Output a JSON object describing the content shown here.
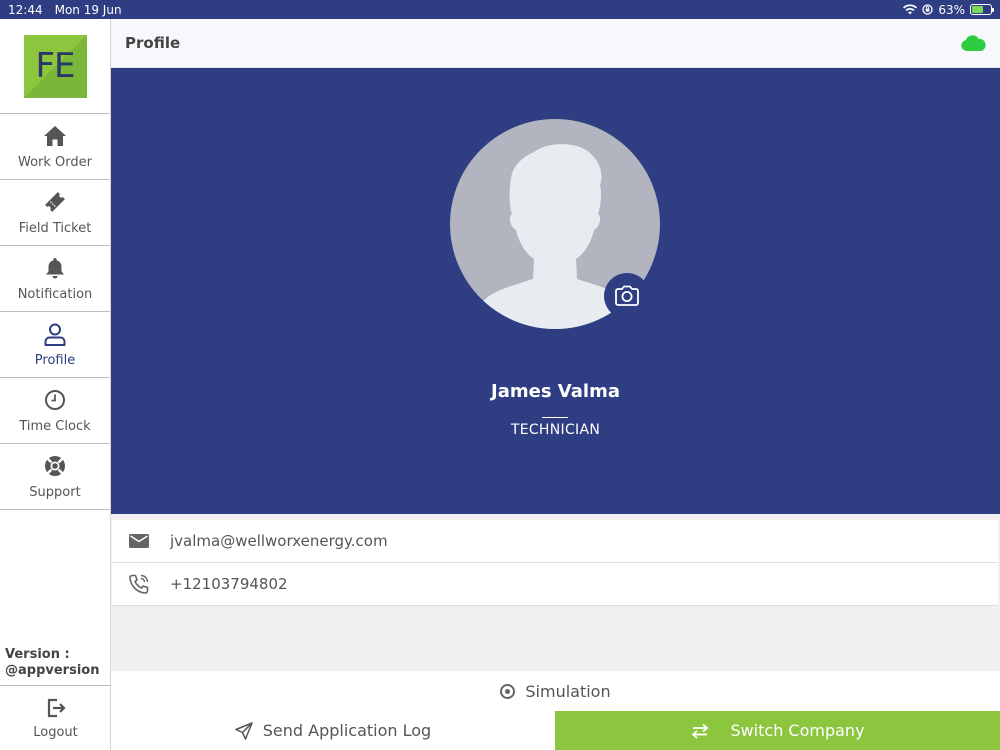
{
  "status_bar": {
    "time": "12:44",
    "date": "Mon 19 Jun",
    "battery": "63%",
    "battery_level": 0.63
  },
  "logo": {
    "text": "FE"
  },
  "sidebar": {
    "items": [
      {
        "label": "Work Order",
        "icon": "home-icon",
        "active": false
      },
      {
        "label": "Field Ticket",
        "icon": "ticket-icon",
        "active": false
      },
      {
        "label": "Notification",
        "icon": "bell-icon",
        "active": false
      },
      {
        "label": "Profile",
        "icon": "user-icon",
        "active": true
      },
      {
        "label": "Time Clock",
        "icon": "clock-icon",
        "active": false
      },
      {
        "label": "Support",
        "icon": "lifebuoy-icon",
        "active": false
      }
    ],
    "version_label": "Version :",
    "version_value": "@appversion",
    "logout_label": "Logout"
  },
  "header": {
    "title": "Profile",
    "sync_icon": "cloud-icon",
    "sync_color": "#2ecc40"
  },
  "profile": {
    "name": "James Valma",
    "role": "TECHNICIAN",
    "email": "jvalma@wellworxenergy.com",
    "phone": "+12103794802"
  },
  "actions": {
    "simulation_label": "Simulation",
    "send_log_label": "Send Application Log",
    "switch_company_label": "Switch Company"
  },
  "colors": {
    "primary": "#2f3e83",
    "accent": "#8cc63f"
  }
}
